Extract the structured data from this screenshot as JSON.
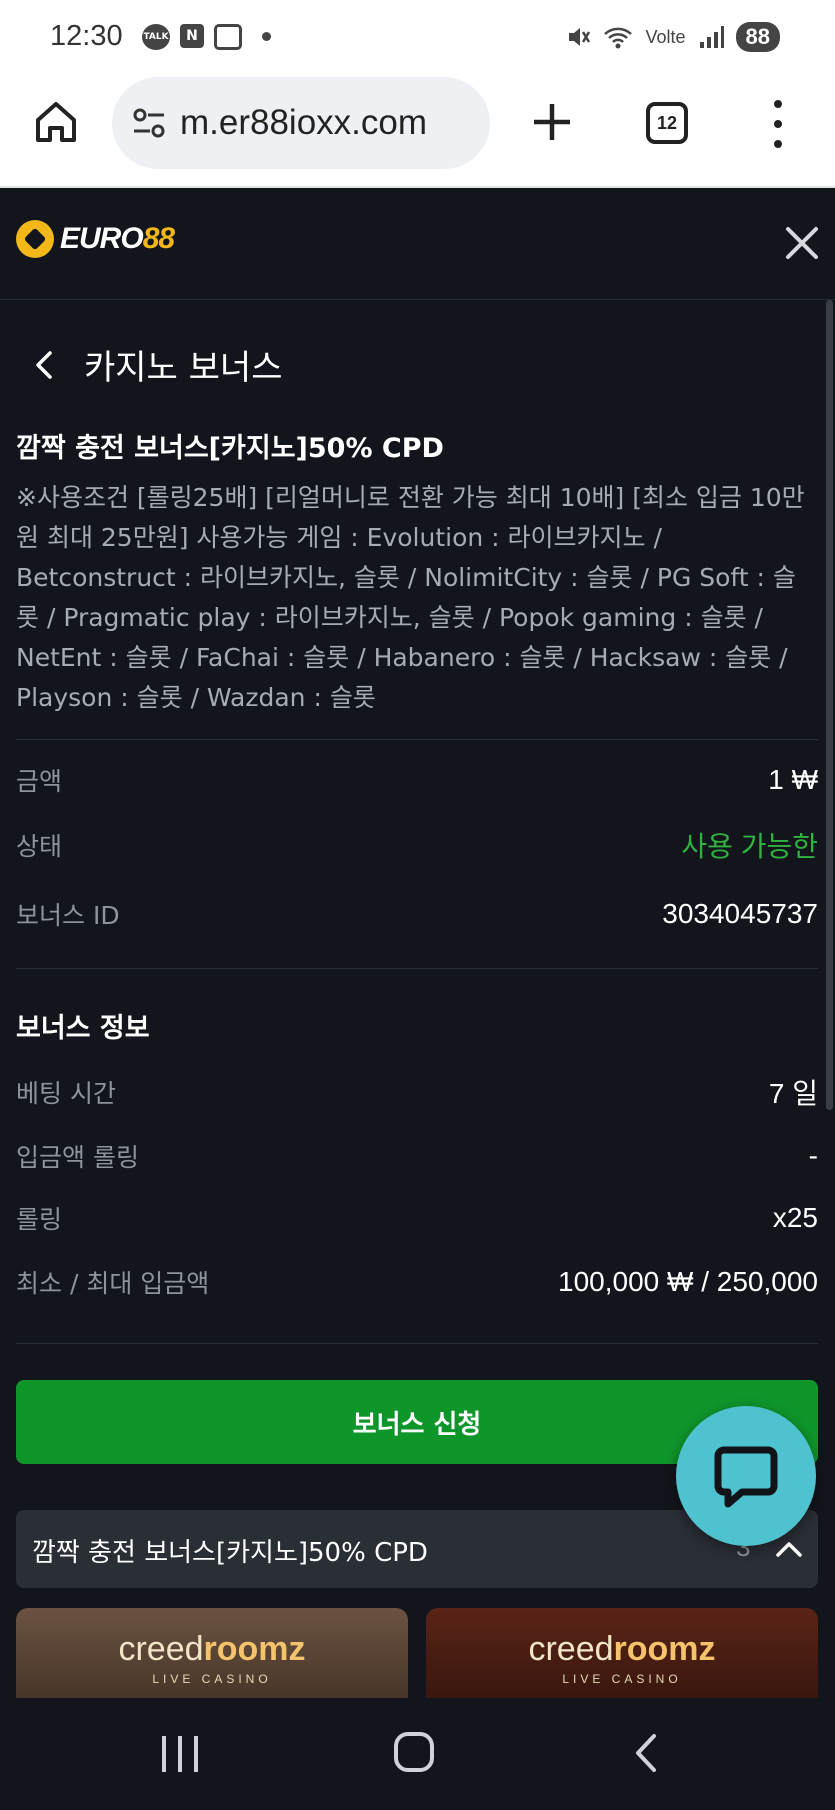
{
  "status_bar": {
    "time": "12:30",
    "talk_icon_label": "TALK",
    "n_icon_label": "N",
    "network_label": "Volte",
    "battery": "88"
  },
  "browser": {
    "url": "m.er88ioxx.com",
    "tab_count": "12"
  },
  "site": {
    "logo_text_a": "EURO",
    "logo_text_b": "88",
    "accent_color": "#f2b81a"
  },
  "page": {
    "title": "카지노 보너스",
    "bonus_title": "깜짝 충전 보너스[카지노]50% CPD",
    "bonus_description": "※사용조건 [롤링25배] [리얼머니로 전환 가능 최대 10배] [최소 입금 10만원 최대 25만원] 사용가능 게임 : Evolution : 라이브카지노 / Betconstruct : 라이브카지노, 슬롯 / NolimitCity : 슬롯 / PG Soft : 슬롯 / Pragmatic play : 라이브카지노, 슬롯 / Popok gaming : 슬롯 / NetEnt : 슬롯 / FaChai : 슬롯 / Habanero : 슬롯 / Hacksaw : 슬롯 / Playson : 슬롯 / Wazdan : 슬롯",
    "details": [
      {
        "label": "금액",
        "value": "1 ₩"
      },
      {
        "label": "상태",
        "value": "사용 가능한"
      },
      {
        "label": "보너스 ID",
        "value": "3034045737"
      }
    ],
    "info_title": "보너스 정보",
    "info": [
      {
        "label": "베팅 시간",
        "value": "7 일"
      },
      {
        "label": "입금액 롤링",
        "value": "-"
      },
      {
        "label": "롤링",
        "value": "x25"
      },
      {
        "label": "최소 / 최대 입금액",
        "value": "100,000 ₩ / 250,000"
      }
    ],
    "apply_button": "보너스 신청",
    "group": {
      "label": "깜짝 충전 보너스[카지노]50% CPD",
      "count": "3"
    },
    "cards": [
      {
        "brand_a": "creed",
        "brand_b": "roomz",
        "sub": "LIVE CASINO"
      },
      {
        "brand_a": "creed",
        "brand_b": "roomz",
        "sub": "LIVE CASINO"
      }
    ],
    "status_color": "#2fb33f",
    "button_color": "#0f962b"
  }
}
